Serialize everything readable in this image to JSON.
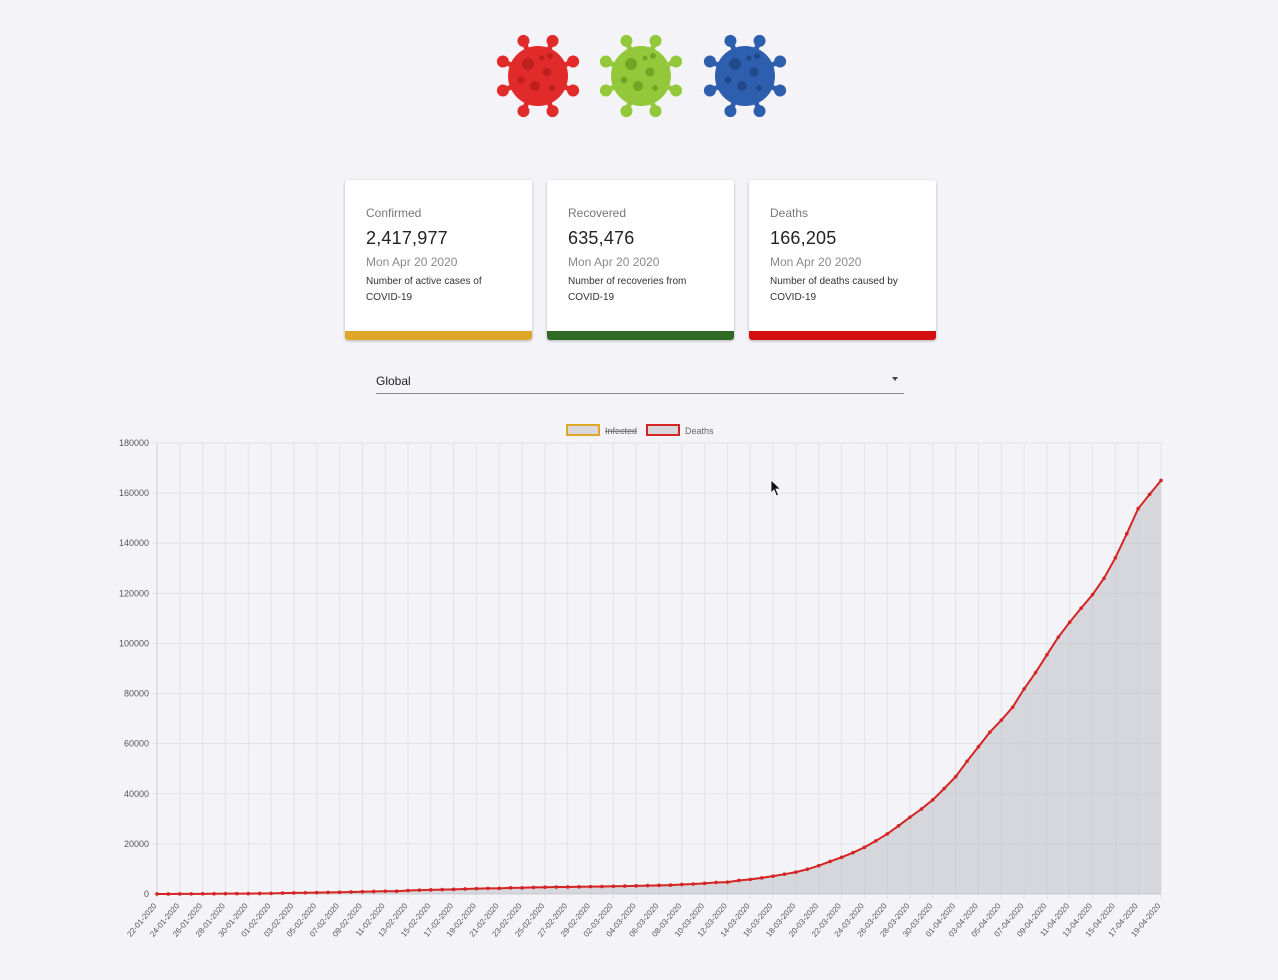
{
  "header": {
    "icons": [
      {
        "name": "virus-red-icon",
        "color": "#e12a2a",
        "dark": "#b81d1d"
      },
      {
        "name": "virus-green-icon",
        "color": "#93c83a",
        "dark": "#6e9d22"
      },
      {
        "name": "virus-blue-icon",
        "color": "#2e5fae",
        "dark": "#1f4586"
      }
    ]
  },
  "cards": [
    {
      "title": "Confirmed",
      "value": "2,417,977",
      "date": "Mon Apr 20 2020",
      "desc": "Number of active cases of COVID-19",
      "bar_color": "#e0a628"
    },
    {
      "title": "Recovered",
      "value": "635,476",
      "date": "Mon Apr 20 2020",
      "desc": "Number of recoveries from COVID-19",
      "bar_color": "#2f6b24"
    },
    {
      "title": "Deaths",
      "value": "166,205",
      "date": "Mon Apr 20 2020",
      "desc": "Number of deaths caused by COVID-19",
      "bar_color": "#d40f0f"
    }
  ],
  "region_select": {
    "value": "Global"
  },
  "chart_data": {
    "type": "area",
    "legend": [
      {
        "name": "Infected",
        "color": "#e0a628",
        "hidden": true
      },
      {
        "name": "Deaths",
        "color": "#d42424",
        "hidden": false
      }
    ],
    "legend_position": "top-center",
    "ylim": [
      0,
      180000
    ],
    "yticks": [
      "0",
      "20000",
      "40000",
      "60000",
      "80000",
      "100000",
      "120000",
      "140000",
      "160000",
      "180000"
    ],
    "grid": true,
    "x": [
      "22-01-2020",
      "23-01-2020",
      "24-01-2020",
      "25-01-2020",
      "26-01-2020",
      "27-01-2020",
      "28-01-2020",
      "29-01-2020",
      "30-01-2020",
      "31-01-2020",
      "01-02-2020",
      "02-02-2020",
      "03-02-2020",
      "04-02-2020",
      "05-02-2020",
      "06-02-2020",
      "07-02-2020",
      "08-02-2020",
      "09-02-2020",
      "10-02-2020",
      "11-02-2020",
      "12-02-2020",
      "13-02-2020",
      "14-02-2020",
      "15-02-2020",
      "16-02-2020",
      "17-02-2020",
      "18-02-2020",
      "19-02-2020",
      "20-02-2020",
      "21-02-2020",
      "22-02-2020",
      "23-02-2020",
      "24-02-2020",
      "25-02-2020",
      "26-02-2020",
      "27-02-2020",
      "28-02-2020",
      "29-02-2020",
      "01-03-2020",
      "02-03-2020",
      "03-03-2020",
      "04-03-2020",
      "05-03-2020",
      "06-03-2020",
      "07-03-2020",
      "08-03-2020",
      "09-03-2020",
      "10-03-2020",
      "11-03-2020",
      "12-03-2020",
      "13-03-2020",
      "14-03-2020",
      "15-03-2020",
      "16-03-2020",
      "17-03-2020",
      "18-03-2020",
      "19-03-2020",
      "20-03-2020",
      "21-03-2020",
      "22-03-2020",
      "23-03-2020",
      "24-03-2020",
      "25-03-2020",
      "26-03-2020",
      "27-03-2020",
      "28-03-2020",
      "29-03-2020",
      "30-03-2020",
      "31-03-2020",
      "01-04-2020",
      "02-04-2020",
      "03-04-2020",
      "04-04-2020",
      "05-04-2020",
      "06-04-2020",
      "07-04-2020",
      "08-04-2020",
      "09-04-2020",
      "10-04-2020",
      "11-04-2020",
      "12-04-2020",
      "13-04-2020",
      "14-04-2020",
      "15-04-2020",
      "16-04-2020",
      "17-04-2020",
      "18-04-2020",
      "19-04-2020"
    ],
    "x_tick_labels": [
      "22-01-2020",
      "24-01-2020",
      "26-01-2020",
      "28-01-2020",
      "30-01-2020",
      "01-02-2020",
      "03-02-2020",
      "05-02-2020",
      "07-02-2020",
      "09-02-2020",
      "11-02-2020",
      "13-02-2020",
      "15-02-2020",
      "17-02-2020",
      "19-02-2020",
      "21-02-2020",
      "23-02-2020",
      "25-02-2020",
      "27-02-2020",
      "29-02-2020",
      "02-03-2020",
      "04-03-2020",
      "06-03-2020",
      "08-03-2020",
      "10-03-2020",
      "12-03-2020",
      "14-03-2020",
      "16-03-2020",
      "18-03-2020",
      "20-03-2020",
      "22-03-2020",
      "24-03-2020",
      "26-03-2020",
      "28-03-2020",
      "30-03-2020",
      "01-04-2020",
      "03-04-2020",
      "05-04-2020",
      "07-04-2020",
      "09-04-2020",
      "11-04-2020",
      "13-04-2020",
      "15-04-2020",
      "17-04-2020",
      "19-04-2020"
    ],
    "series": [
      {
        "name": "Deaths",
        "values": [
          17,
          18,
          26,
          42,
          56,
          82,
          131,
          133,
          171,
          213,
          259,
          362,
          426,
          492,
          564,
          634,
          719,
          806,
          906,
          1013,
          1113,
          1118,
          1371,
          1523,
          1666,
          1770,
          1868,
          2007,
          2122,
          2247,
          2251,
          2458,
          2469,
          2629,
          2708,
          2770,
          2814,
          2872,
          2941,
          2996,
          3085,
          3160,
          3254,
          3348,
          3460,
          3558,
          3802,
          3988,
          4262,
          4615,
          4720,
          5404,
          5819,
          6440,
          7126,
          7905,
          8733,
          9867,
          11299,
          13005,
          14623,
          16497,
          18615,
          21181,
          23970,
          27198,
          30652,
          33925,
          37582,
          42107,
          46809,
          52983,
          58787,
          64606,
          69374,
          74565,
          81865,
          88338,
          95455,
          102525,
          108503,
          114091,
          119482,
          125983,
          134176,
          143800,
          153822,
          159510,
          165044
        ]
      }
    ]
  }
}
